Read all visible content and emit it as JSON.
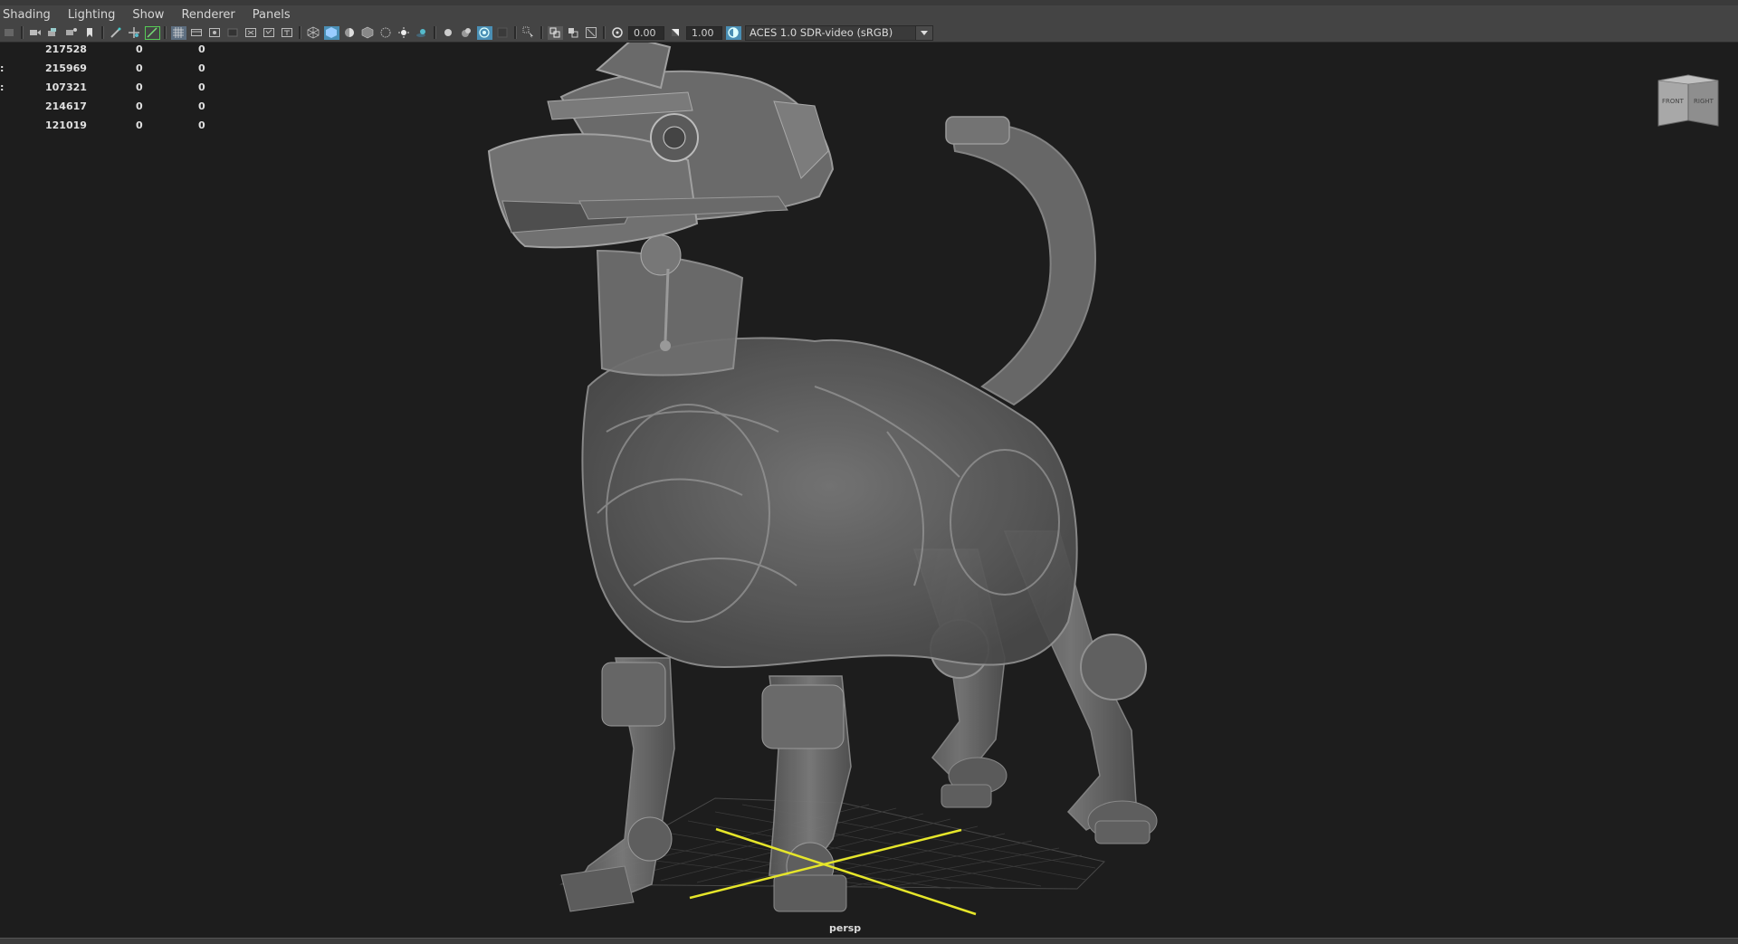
{
  "menubar": {
    "items": [
      "Shading",
      "Lighting",
      "Show",
      "Renderer",
      "Panels"
    ]
  },
  "toolbar": {
    "icons": [
      "select-camera-icon",
      "camera-attributes-icon",
      "bookmark-camera-icon",
      "image-plane-icon",
      "bookmark-icon",
      "grease-pencil-icon",
      "2d-pan-zoom-icon",
      "wireframe-toggle-icon",
      "grid-icon",
      "film-gate-icon",
      "resolution-gate-icon",
      "gate-mask-icon",
      "field-chart-icon",
      "safe-action-icon",
      "safe-title-icon",
      "wireframe-icon",
      "smooth-shade-icon",
      "default-material-icon",
      "textured-icon",
      "use-lights-icon",
      "shadows-icon",
      "ambient-occlusion-icon",
      "motion-blur-icon",
      "anti-aliasing-icon",
      "depth-of-field-icon",
      "isolate-select-icon",
      "xray-icon",
      "xray-joints-icon",
      "xray-components-icon",
      "exposure-icon",
      "gamma-icon",
      "color-management-icon"
    ],
    "exposure_value": "0.00",
    "gamma_value": "1.00",
    "color_space": "ACES 1.0 SDR-video (sRGB)"
  },
  "hud": {
    "rows": [
      {
        "label": "",
        "c1": "217528",
        "c2": "0",
        "c3": "0"
      },
      {
        "label": ":",
        "c1": "215969",
        "c2": "0",
        "c3": "0"
      },
      {
        "label": ":",
        "c1": "107321",
        "c2": "0",
        "c3": "0"
      },
      {
        "label": "",
        "c1": "214617",
        "c2": "0",
        "c3": "0"
      },
      {
        "label": "",
        "c1": "121019",
        "c2": "0",
        "c3": "0"
      }
    ]
  },
  "viewcube": {
    "front_label": "FRONT",
    "right_label": "RIGHT"
  },
  "viewport": {
    "camera_label": "persp",
    "model": "robot-dog-model",
    "manipulator_color": "#e6e62a"
  }
}
